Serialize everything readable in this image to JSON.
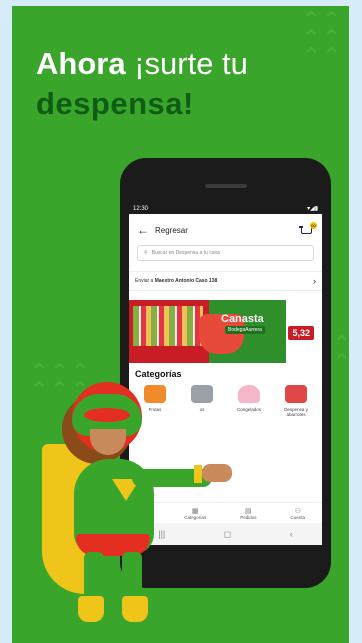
{
  "headline": {
    "line1_bold": "Ahora",
    "line1_rest": " ¡surte tu",
    "line2": "despensa!"
  },
  "phone": {
    "status": {
      "time": "12:30",
      "icons": "▾◢▮"
    },
    "topbar": {
      "back_label": "Regresar",
      "cart_count": "00"
    },
    "search": {
      "placeholder": "Buscar en Despensa a tu casa"
    },
    "delivery": {
      "prefix": "Enviar a",
      "address": "Maestro Antonio Caso 138"
    },
    "banner": {
      "title_line1": "Canasta",
      "title_line2": "BodegaAurrera",
      "price": "5,32"
    },
    "categories_title": "Categorías",
    "categories": [
      {
        "label": "Frutas",
        "color": "#f08a2a"
      },
      {
        "label": "os",
        "color": "#9aa0a6"
      },
      {
        "label": "Congelados",
        "color": "#f4b6c8"
      },
      {
        "label": "Despensa y abarrotes",
        "color": "#e04848"
      }
    ],
    "nav": [
      {
        "icon": "home-icon",
        "label": ""
      },
      {
        "icon": "grid-icon",
        "label": "Categorías"
      },
      {
        "icon": "receipt-icon",
        "label": "Pedidos"
      },
      {
        "icon": "user-icon",
        "label": "Cuenta"
      }
    ],
    "system": {
      "recent": "|||",
      "home": "◻",
      "back": "‹"
    }
  },
  "colors": {
    "brand_green": "#3aa52b",
    "dark_green": "#0f5d14",
    "accent_red": "#c81d25",
    "accent_yellow": "#f5c400"
  }
}
